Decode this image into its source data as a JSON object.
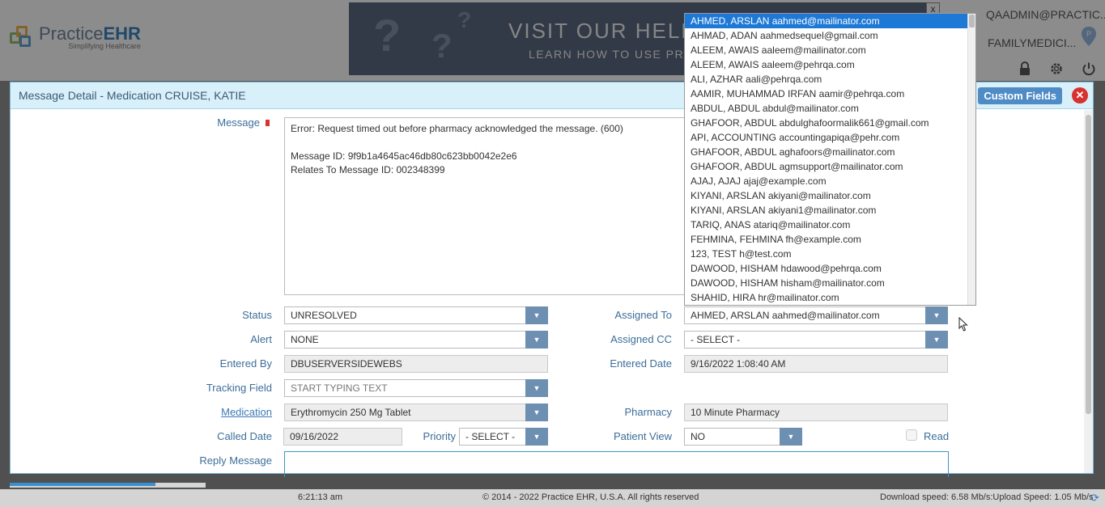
{
  "header": {
    "brand_prefix": "Practice",
    "brand_suffix": "EHR",
    "tagline": "Simplifying Healthcare",
    "banner_line1": "VISIT OUR HELP",
    "banner_line2": "LEARN HOW TO USE PRAC",
    "banner_close": "x",
    "user": "QAADMIN@PRACTIC...",
    "practice": "FAMILYMEDICI...",
    "icons": [
      "lock-icon",
      "gear-icon",
      "power-icon"
    ]
  },
  "dialog": {
    "title": "Message Detail - Medication CRUISE, KATIE",
    "custom_fields_label": "Custom Fields",
    "close_glyph": "✕",
    "message_label": "Message",
    "message_text": "Error: Request timed out before pharmacy acknowledged the message. (600)\n\nMessage ID: 9f9b1a4645ac46db80c623bb0042e2e6\nRelates To Message ID: 002348399",
    "status_label": "Status",
    "status_value": "UNRESOLVED",
    "alert_label": "Alert",
    "alert_value": "NONE",
    "entered_by_label": "Entered By",
    "entered_by_value": "DBUSERVERSIDEWEBS",
    "tracking_label": "Tracking Field",
    "tracking_placeholder": "START TYPING TEXT",
    "medication_label": "Medication",
    "medication_value": "Erythromycin 250 Mg Tablet",
    "called_date_label": "Called Date",
    "called_date_value": "09/16/2022",
    "priority_label": "Priority",
    "priority_value": "- SELECT -",
    "reply_label": "Reply Message",
    "assigned_to_label": "Assigned To",
    "assigned_to_value": "AHMED, ARSLAN aahmed@mailinator.com",
    "assigned_cc_label": "Assigned CC",
    "assigned_cc_value": "- SELECT -",
    "entered_date_label": "Entered Date",
    "entered_date_value": "9/16/2022 1:08:40 AM",
    "pharmacy_label": "Pharmacy",
    "pharmacy_value": "10 Minute Pharmacy",
    "patient_view_label": "Patient View",
    "patient_view_value": "NO",
    "read_label": "Read",
    "read_checked": false
  },
  "assignee_options": [
    "AHMED, ARSLAN aahmed@mailinator.com",
    "AHMAD, ADAN aahmedsequel@gmail.com",
    "ALEEM, AWAIS aaleem@mailinator.com",
    "ALEEM, AWAIS aaleem@pehrqa.com",
    "ALI, AZHAR aali@pehrqa.com",
    "AAMIR, MUHAMMAD IRFAN aamir@pehrqa.com",
    "ABDUL, ABDUL abdul@mailinator.com",
    "GHAFOOR, ABDUL abdulghafoormalik661@gmail.com",
    "API, ACCOUNTING accountingapiqa@pehr.com",
    "GHAFOOR, ABDUL aghafoors@mailinator.com",
    "GHAFOOR, ABDUL agmsupport@mailinator.com",
    "AJAJ, AJAJ ajaj@example.com",
    "KIYANI, ARSLAN akiyani@mailinator.com",
    "KIYANI, ARSLAN akiyani1@mailinator.com",
    "TARIQ, ANAS atariq@mailinator.com",
    "FEHMINA, FEHMINA fh@example.com",
    "123, TEST h@test.com",
    "DAWOOD, HISHAM hdawood@pehrqa.com",
    "DAWOOD, HISHAM hisham@mailinator.com",
    "SHAHID, HIRA hr@mailinator.com"
  ],
  "selected_option_index": 0,
  "footer": {
    "time": "6:21:13 am",
    "copyright": "© 2014 - 2022 Practice EHR, U.S.A. All rights reserved",
    "speed": "Download speed: 6.58 Mb/s:Upload Speed: 1.05 Mb/s"
  },
  "colors": {
    "accent": "#4f8bc5",
    "close_red": "#d9312e",
    "selected_option": "#1e78d6",
    "label_blue": "#3c6e9a"
  }
}
